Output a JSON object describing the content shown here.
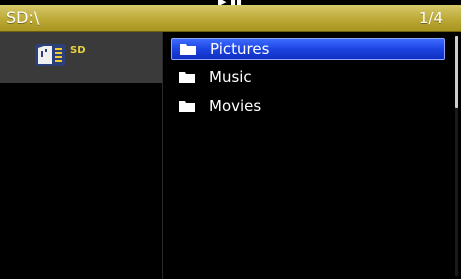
{
  "header": {
    "path": "SD:\\",
    "page_indicator": "1/4"
  },
  "devices": [
    {
      "label": "SD",
      "icon": "sd-card-icon",
      "selected": true
    }
  ],
  "files": [
    {
      "name": "Pictures",
      "icon": "folder-icon",
      "selected": true
    },
    {
      "name": "Music",
      "icon": "folder-icon",
      "selected": false
    },
    {
      "name": "Movies",
      "icon": "folder-icon",
      "selected": false
    }
  ],
  "colors": {
    "header": "#bca936",
    "selection": "#1d44e2",
    "device_label": "#e8d23a"
  }
}
